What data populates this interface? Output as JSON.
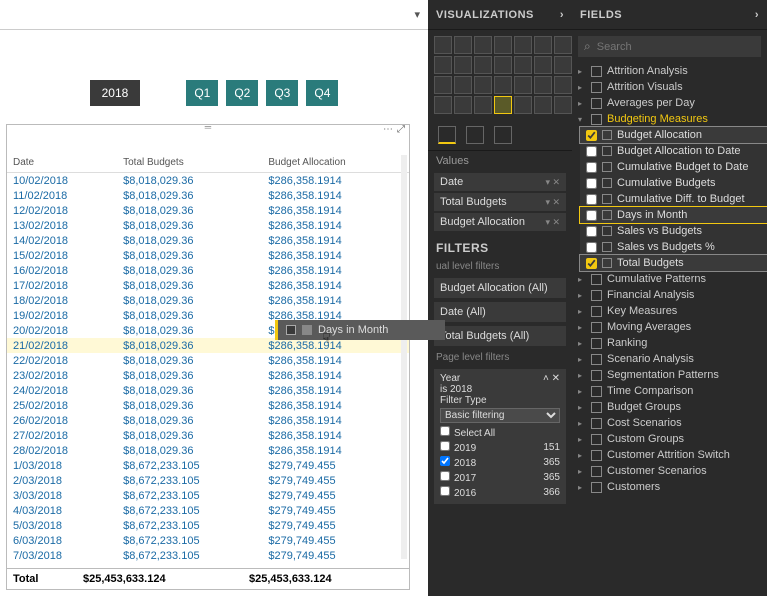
{
  "slicers": {
    "year": "2018",
    "quarters": [
      "Q1",
      "Q2",
      "Q3",
      "Q4"
    ]
  },
  "table": {
    "headers": [
      "Date",
      "Total Budgets",
      "Budget Allocation"
    ],
    "rows": [
      [
        "10/02/2018",
        "$8,018,029.36",
        "$286,358.1914"
      ],
      [
        "11/02/2018",
        "$8,018,029.36",
        "$286,358.1914"
      ],
      [
        "12/02/2018",
        "$8,018,029.36",
        "$286,358.1914"
      ],
      [
        "13/02/2018",
        "$8,018,029.36",
        "$286,358.1914"
      ],
      [
        "14/02/2018",
        "$8,018,029.36",
        "$286,358.1914"
      ],
      [
        "15/02/2018",
        "$8,018,029.36",
        "$286,358.1914"
      ],
      [
        "16/02/2018",
        "$8,018,029.36",
        "$286,358.1914"
      ],
      [
        "17/02/2018",
        "$8,018,029.36",
        "$286,358.1914"
      ],
      [
        "18/02/2018",
        "$8,018,029.36",
        "$286,358.1914"
      ],
      [
        "19/02/2018",
        "$8,018,029.36",
        "$286,358.1914"
      ],
      [
        "20/02/2018",
        "$8,018,029.36",
        "$286,358.1914"
      ],
      [
        "21/02/2018",
        "$8,018,029.36",
        "$286,358.1914"
      ],
      [
        "22/02/2018",
        "$8,018,029.36",
        "$286,358.1914"
      ],
      [
        "23/02/2018",
        "$8,018,029.36",
        "$286,358.1914"
      ],
      [
        "24/02/2018",
        "$8,018,029.36",
        "$286,358.1914"
      ],
      [
        "25/02/2018",
        "$8,018,029.36",
        "$286,358.1914"
      ],
      [
        "26/02/2018",
        "$8,018,029.36",
        "$286,358.1914"
      ],
      [
        "27/02/2018",
        "$8,018,029.36",
        "$286,358.1914"
      ],
      [
        "28/02/2018",
        "$8,018,029.36",
        "$286,358.1914"
      ],
      [
        "1/03/2018",
        "$8,672,233.105",
        "$279,749.455"
      ],
      [
        "2/03/2018",
        "$8,672,233.105",
        "$279,749.455"
      ],
      [
        "3/03/2018",
        "$8,672,233.105",
        "$279,749.455"
      ],
      [
        "4/03/2018",
        "$8,672,233.105",
        "$279,749.455"
      ],
      [
        "5/03/2018",
        "$8,672,233.105",
        "$279,749.455"
      ],
      [
        "6/03/2018",
        "$8,672,233.105",
        "$279,749.455"
      ],
      [
        "7/03/2018",
        "$8,672,233.105",
        "$279,749.455"
      ]
    ],
    "total": [
      "Total",
      "$25,453,633.124",
      "$25,453,633.124"
    ]
  },
  "drag": {
    "label": "Days in Month"
  },
  "viz_panel": {
    "title": "VISUALIZATIONS",
    "values_label": "Values",
    "wells": [
      "Date",
      "Total Budgets",
      "Budget Allocation"
    ],
    "filters_title": "FILTERS",
    "visual_level_label": "ual level filters",
    "visual_filters": [
      "Budget Allocation (All)",
      "Date (All)",
      "Total Budgets (All)"
    ],
    "page_level_label": "Page level filters",
    "year_filter": {
      "title": "Year",
      "subtitle": "is 2018",
      "type_label": "Filter Type",
      "type_value": "Basic filtering",
      "select_all": "Select All",
      "options": [
        {
          "label": "2019",
          "count": "151",
          "checked": false
        },
        {
          "label": "2018",
          "count": "365",
          "checked": true
        },
        {
          "label": "2017",
          "count": "365",
          "checked": false
        },
        {
          "label": "2016",
          "count": "366",
          "checked": false
        }
      ]
    }
  },
  "fields_panel": {
    "title": "FIELDS",
    "search_placeholder": "Search",
    "tables": [
      {
        "name": "Attrition Analysis",
        "expanded": false
      },
      {
        "name": "Attrition Visuals",
        "expanded": false
      },
      {
        "name": "Averages per Day",
        "expanded": false
      },
      {
        "name": "Budgeting Measures",
        "expanded": true,
        "fields": [
          {
            "name": "Budget Allocation",
            "checked": true,
            "hl": false
          },
          {
            "name": "Budget Allocation to Date",
            "checked": false,
            "hl": false
          },
          {
            "name": "Cumulative Budget to Date",
            "checked": false,
            "hl": false
          },
          {
            "name": "Cumulative Budgets",
            "checked": false,
            "hl": false
          },
          {
            "name": "Cumulative Diff. to Budget",
            "checked": false,
            "hl": false
          },
          {
            "name": "Days in Month",
            "checked": false,
            "hl": true
          },
          {
            "name": "Sales vs Budgets",
            "checked": false,
            "hl": false
          },
          {
            "name": "Sales vs Budgets %",
            "checked": false,
            "hl": false
          },
          {
            "name": "Total Budgets",
            "checked": true,
            "hl": false
          }
        ]
      },
      {
        "name": "Cumulative Patterns",
        "expanded": false
      },
      {
        "name": "Financial Analysis",
        "expanded": false
      },
      {
        "name": "Key Measures",
        "expanded": false
      },
      {
        "name": "Moving Averages",
        "expanded": false
      },
      {
        "name": "Ranking",
        "expanded": false
      },
      {
        "name": "Scenario Analysis",
        "expanded": false
      },
      {
        "name": "Segmentation Patterns",
        "expanded": false
      },
      {
        "name": "Time Comparison",
        "expanded": false
      },
      {
        "name": "Budget Groups",
        "expanded": false
      },
      {
        "name": "Cost Scenarios",
        "expanded": false
      },
      {
        "name": "Custom Groups",
        "expanded": false
      },
      {
        "name": "Customer Attrition Switch",
        "expanded": false
      },
      {
        "name": "Customer Scenarios",
        "expanded": false
      },
      {
        "name": "Customers",
        "expanded": false
      }
    ]
  }
}
